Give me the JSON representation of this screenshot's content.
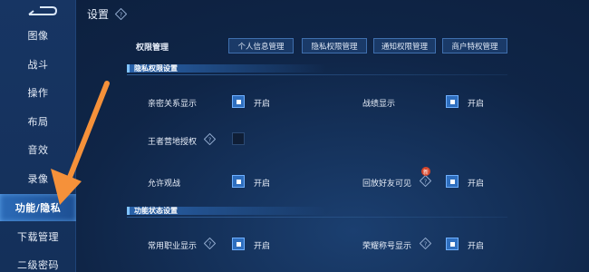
{
  "header": {
    "title": "设置"
  },
  "sidebar": {
    "items": [
      {
        "label": "图像"
      },
      {
        "label": "战斗"
      },
      {
        "label": "操作"
      },
      {
        "label": "布局"
      },
      {
        "label": "音效"
      },
      {
        "label": "录像"
      },
      {
        "label": "功能/隐私",
        "active": true
      },
      {
        "label": "下载管理"
      },
      {
        "label": "二级密码"
      }
    ]
  },
  "permissions": {
    "label": "权限管理",
    "buttons": [
      "个人信息管理",
      "隐私权限管理",
      "通知权限管理",
      "商户特权管理"
    ]
  },
  "privacy_section": {
    "title": "隐私权限设置",
    "settings": [
      {
        "label": "亲密关系显示",
        "state": "开启",
        "checked": true
      },
      {
        "label": "战绩显示",
        "state": "开启",
        "checked": true
      },
      {
        "label": "王者营地授权",
        "state": "",
        "checked": false
      },
      {
        "label": "允许观战",
        "state": "开启",
        "checked": true
      },
      {
        "label": "回放好友可见",
        "state": "开启",
        "checked": true,
        "badge": "新"
      }
    ]
  },
  "function_section": {
    "title": "功能状态设置",
    "settings": [
      {
        "label": "常用职业显示",
        "state": "开启",
        "checked": true
      },
      {
        "label": "荣耀称号显示",
        "state": "开启",
        "checked": true
      }
    ]
  },
  "colors": {
    "background": "#0f2547",
    "sidebar": "#173563",
    "active_item": "#2c6bb8",
    "checkbox_on": "#2f6fbf",
    "arrow": "#f5913a"
  }
}
